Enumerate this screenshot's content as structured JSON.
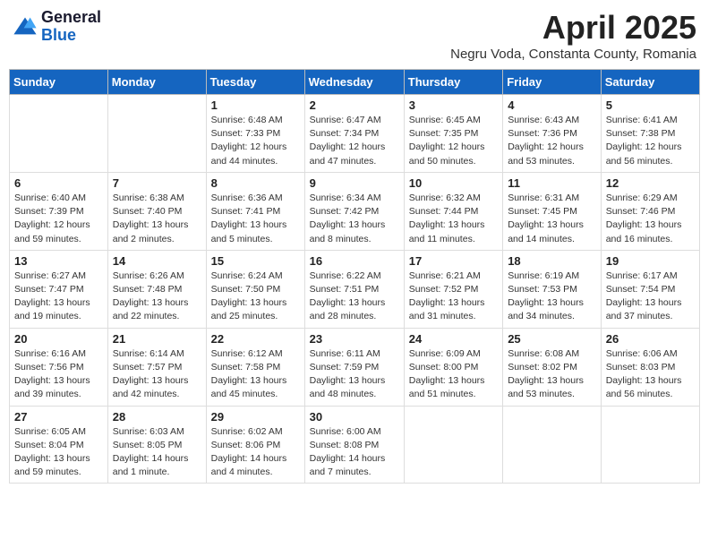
{
  "header": {
    "logo_general": "General",
    "logo_blue": "Blue",
    "month_year": "April 2025",
    "location": "Negru Voda, Constanta County, Romania"
  },
  "calendar": {
    "days_of_week": [
      "Sunday",
      "Monday",
      "Tuesday",
      "Wednesday",
      "Thursday",
      "Friday",
      "Saturday"
    ],
    "rows": [
      [
        {
          "day": "",
          "info": ""
        },
        {
          "day": "",
          "info": ""
        },
        {
          "day": "1",
          "info": "Sunrise: 6:48 AM\nSunset: 7:33 PM\nDaylight: 12 hours and 44 minutes."
        },
        {
          "day": "2",
          "info": "Sunrise: 6:47 AM\nSunset: 7:34 PM\nDaylight: 12 hours and 47 minutes."
        },
        {
          "day": "3",
          "info": "Sunrise: 6:45 AM\nSunset: 7:35 PM\nDaylight: 12 hours and 50 minutes."
        },
        {
          "day": "4",
          "info": "Sunrise: 6:43 AM\nSunset: 7:36 PM\nDaylight: 12 hours and 53 minutes."
        },
        {
          "day": "5",
          "info": "Sunrise: 6:41 AM\nSunset: 7:38 PM\nDaylight: 12 hours and 56 minutes."
        }
      ],
      [
        {
          "day": "6",
          "info": "Sunrise: 6:40 AM\nSunset: 7:39 PM\nDaylight: 12 hours and 59 minutes."
        },
        {
          "day": "7",
          "info": "Sunrise: 6:38 AM\nSunset: 7:40 PM\nDaylight: 13 hours and 2 minutes."
        },
        {
          "day": "8",
          "info": "Sunrise: 6:36 AM\nSunset: 7:41 PM\nDaylight: 13 hours and 5 minutes."
        },
        {
          "day": "9",
          "info": "Sunrise: 6:34 AM\nSunset: 7:42 PM\nDaylight: 13 hours and 8 minutes."
        },
        {
          "day": "10",
          "info": "Sunrise: 6:32 AM\nSunset: 7:44 PM\nDaylight: 13 hours and 11 minutes."
        },
        {
          "day": "11",
          "info": "Sunrise: 6:31 AM\nSunset: 7:45 PM\nDaylight: 13 hours and 14 minutes."
        },
        {
          "day": "12",
          "info": "Sunrise: 6:29 AM\nSunset: 7:46 PM\nDaylight: 13 hours and 16 minutes."
        }
      ],
      [
        {
          "day": "13",
          "info": "Sunrise: 6:27 AM\nSunset: 7:47 PM\nDaylight: 13 hours and 19 minutes."
        },
        {
          "day": "14",
          "info": "Sunrise: 6:26 AM\nSunset: 7:48 PM\nDaylight: 13 hours and 22 minutes."
        },
        {
          "day": "15",
          "info": "Sunrise: 6:24 AM\nSunset: 7:50 PM\nDaylight: 13 hours and 25 minutes."
        },
        {
          "day": "16",
          "info": "Sunrise: 6:22 AM\nSunset: 7:51 PM\nDaylight: 13 hours and 28 minutes."
        },
        {
          "day": "17",
          "info": "Sunrise: 6:21 AM\nSunset: 7:52 PM\nDaylight: 13 hours and 31 minutes."
        },
        {
          "day": "18",
          "info": "Sunrise: 6:19 AM\nSunset: 7:53 PM\nDaylight: 13 hours and 34 minutes."
        },
        {
          "day": "19",
          "info": "Sunrise: 6:17 AM\nSunset: 7:54 PM\nDaylight: 13 hours and 37 minutes."
        }
      ],
      [
        {
          "day": "20",
          "info": "Sunrise: 6:16 AM\nSunset: 7:56 PM\nDaylight: 13 hours and 39 minutes."
        },
        {
          "day": "21",
          "info": "Sunrise: 6:14 AM\nSunset: 7:57 PM\nDaylight: 13 hours and 42 minutes."
        },
        {
          "day": "22",
          "info": "Sunrise: 6:12 AM\nSunset: 7:58 PM\nDaylight: 13 hours and 45 minutes."
        },
        {
          "day": "23",
          "info": "Sunrise: 6:11 AM\nSunset: 7:59 PM\nDaylight: 13 hours and 48 minutes."
        },
        {
          "day": "24",
          "info": "Sunrise: 6:09 AM\nSunset: 8:00 PM\nDaylight: 13 hours and 51 minutes."
        },
        {
          "day": "25",
          "info": "Sunrise: 6:08 AM\nSunset: 8:02 PM\nDaylight: 13 hours and 53 minutes."
        },
        {
          "day": "26",
          "info": "Sunrise: 6:06 AM\nSunset: 8:03 PM\nDaylight: 13 hours and 56 minutes."
        }
      ],
      [
        {
          "day": "27",
          "info": "Sunrise: 6:05 AM\nSunset: 8:04 PM\nDaylight: 13 hours and 59 minutes."
        },
        {
          "day": "28",
          "info": "Sunrise: 6:03 AM\nSunset: 8:05 PM\nDaylight: 14 hours and 1 minute."
        },
        {
          "day": "29",
          "info": "Sunrise: 6:02 AM\nSunset: 8:06 PM\nDaylight: 14 hours and 4 minutes."
        },
        {
          "day": "30",
          "info": "Sunrise: 6:00 AM\nSunset: 8:08 PM\nDaylight: 14 hours and 7 minutes."
        },
        {
          "day": "",
          "info": ""
        },
        {
          "day": "",
          "info": ""
        },
        {
          "day": "",
          "info": ""
        }
      ]
    ]
  }
}
